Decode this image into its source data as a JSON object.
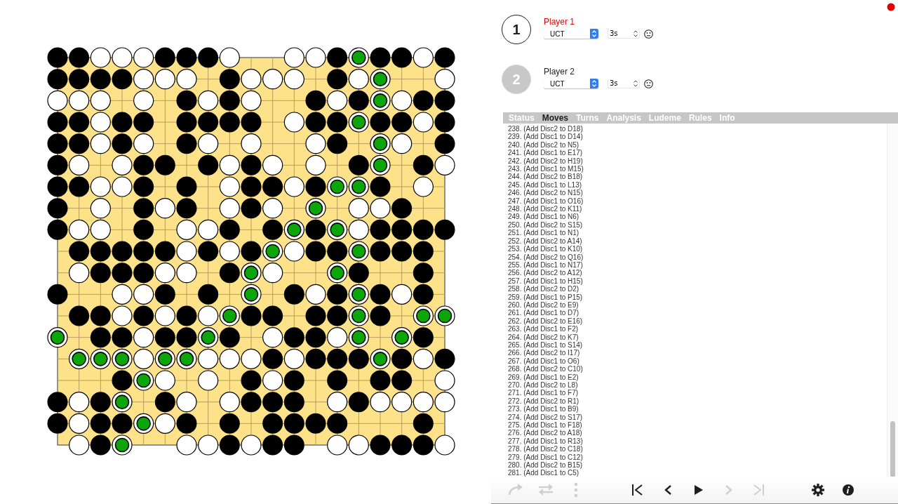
{
  "board": {
    "rows": [
      {
        "cells": [
          {
            "kind": "black"
          },
          {
            "kind": "black"
          },
          {
            "kind": "white"
          },
          {
            "kind": "white"
          },
          {
            "kind": "white"
          },
          {
            "kind": "black"
          },
          {
            "kind": "black"
          },
          {
            "kind": "black"
          },
          {
            "kind": "white"
          },
          {
            "kind": "empty"
          },
          {
            "kind": "empty"
          },
          {
            "kind": "white"
          },
          {
            "kind": "white"
          },
          {
            "kind": "black"
          },
          {
            "kind": "marked"
          },
          {
            "kind": "black"
          },
          {
            "kind": "black"
          },
          {
            "kind": "white"
          },
          {
            "kind": "black"
          }
        ]
      },
      {
        "cells": [
          {
            "kind": "black"
          },
          {
            "kind": "black"
          },
          {
            "kind": "black"
          },
          {
            "kind": "black"
          },
          {
            "kind": "white"
          },
          {
            "kind": "white"
          },
          {
            "kind": "white"
          },
          {
            "kind": "empty"
          },
          {
            "kind": "black"
          },
          {
            "kind": "white"
          },
          {
            "kind": "white"
          },
          {
            "kind": "white"
          },
          {
            "kind": "empty"
          },
          {
            "kind": "black"
          },
          {
            "kind": "white"
          },
          {
            "kind": "marked"
          },
          {
            "kind": "empty"
          },
          {
            "kind": "empty"
          },
          {
            "kind": "white"
          }
        ]
      },
      {
        "cells": [
          {
            "kind": "white"
          },
          {
            "kind": "white"
          },
          {
            "kind": "white"
          },
          {
            "kind": "empty"
          },
          {
            "kind": "white"
          },
          {
            "kind": "empty"
          },
          {
            "kind": "black"
          },
          {
            "kind": "white"
          },
          {
            "kind": "black"
          },
          {
            "kind": "white"
          },
          {
            "kind": "empty"
          },
          {
            "kind": "empty"
          },
          {
            "kind": "black"
          },
          {
            "kind": "white"
          },
          {
            "kind": "black"
          },
          {
            "kind": "marked"
          },
          {
            "kind": "white"
          },
          {
            "kind": "black"
          },
          {
            "kind": "black"
          }
        ]
      },
      {
        "cells": [
          {
            "kind": "black"
          },
          {
            "kind": "black"
          },
          {
            "kind": "white"
          },
          {
            "kind": "black"
          },
          {
            "kind": "black"
          },
          {
            "kind": "empty"
          },
          {
            "kind": "black"
          },
          {
            "kind": "black"
          },
          {
            "kind": "black"
          },
          {
            "kind": "black"
          },
          {
            "kind": "empty"
          },
          {
            "kind": "white"
          },
          {
            "kind": "black"
          },
          {
            "kind": "black"
          },
          {
            "kind": "marked"
          },
          {
            "kind": "black"
          },
          {
            "kind": "black"
          },
          {
            "kind": "white"
          },
          {
            "kind": "black"
          }
        ]
      },
      {
        "cells": [
          {
            "kind": "black"
          },
          {
            "kind": "black"
          },
          {
            "kind": "white"
          },
          {
            "kind": "black"
          },
          {
            "kind": "white"
          },
          {
            "kind": "empty"
          },
          {
            "kind": "black"
          },
          {
            "kind": "white"
          },
          {
            "kind": "empty"
          },
          {
            "kind": "white"
          },
          {
            "kind": "empty"
          },
          {
            "kind": "empty"
          },
          {
            "kind": "white"
          },
          {
            "kind": "black"
          },
          {
            "kind": "empty"
          },
          {
            "kind": "marked"
          },
          {
            "kind": "white"
          },
          {
            "kind": "empty"
          },
          {
            "kind": "black"
          }
        ]
      },
      {
        "cells": [
          {
            "kind": "black"
          },
          {
            "kind": "white"
          },
          {
            "kind": "empty"
          },
          {
            "kind": "white"
          },
          {
            "kind": "black"
          },
          {
            "kind": "black"
          },
          {
            "kind": "empty"
          },
          {
            "kind": "black"
          },
          {
            "kind": "white"
          },
          {
            "kind": "black"
          },
          {
            "kind": "white"
          },
          {
            "kind": "empty"
          },
          {
            "kind": "white"
          },
          {
            "kind": "empty"
          },
          {
            "kind": "black"
          },
          {
            "kind": "marked"
          },
          {
            "kind": "empty"
          },
          {
            "kind": "black"
          },
          {
            "kind": "white"
          }
        ]
      },
      {
        "cells": [
          {
            "kind": "black"
          },
          {
            "kind": "black"
          },
          {
            "kind": "white"
          },
          {
            "kind": "white"
          },
          {
            "kind": "black"
          },
          {
            "kind": "empty"
          },
          {
            "kind": "black"
          },
          {
            "kind": "empty"
          },
          {
            "kind": "white"
          },
          {
            "kind": "black"
          },
          {
            "kind": "black"
          },
          {
            "kind": "white"
          },
          {
            "kind": "black"
          },
          {
            "kind": "marked"
          },
          {
            "kind": "marked"
          },
          {
            "kind": "black"
          },
          {
            "kind": "empty"
          },
          {
            "kind": "white"
          },
          {
            "kind": "empty"
          }
        ]
      },
      {
        "cells": [
          {
            "kind": "black"
          },
          {
            "kind": "empty"
          },
          {
            "kind": "white"
          },
          {
            "kind": "empty"
          },
          {
            "kind": "black"
          },
          {
            "kind": "white"
          },
          {
            "kind": "black"
          },
          {
            "kind": "empty"
          },
          {
            "kind": "white"
          },
          {
            "kind": "black"
          },
          {
            "kind": "white"
          },
          {
            "kind": "empty"
          },
          {
            "kind": "marked"
          },
          {
            "kind": "empty"
          },
          {
            "kind": "white"
          },
          {
            "kind": "white"
          },
          {
            "kind": "black"
          },
          {
            "kind": "empty"
          },
          {
            "kind": "empty"
          }
        ]
      },
      {
        "cells": [
          {
            "kind": "black"
          },
          {
            "kind": "white"
          },
          {
            "kind": "white"
          },
          {
            "kind": "empty"
          },
          {
            "kind": "black"
          },
          {
            "kind": "empty"
          },
          {
            "kind": "white"
          },
          {
            "kind": "white"
          },
          {
            "kind": "black"
          },
          {
            "kind": "empty"
          },
          {
            "kind": "black"
          },
          {
            "kind": "marked"
          },
          {
            "kind": "black"
          },
          {
            "kind": "marked"
          },
          {
            "kind": "white"
          },
          {
            "kind": "black"
          },
          {
            "kind": "black"
          },
          {
            "kind": "black"
          },
          {
            "kind": "black"
          }
        ]
      },
      {
        "cells": [
          {
            "kind": "empty"
          },
          {
            "kind": "black"
          },
          {
            "kind": "black"
          },
          {
            "kind": "black"
          },
          {
            "kind": "black"
          },
          {
            "kind": "black"
          },
          {
            "kind": "white"
          },
          {
            "kind": "black"
          },
          {
            "kind": "white"
          },
          {
            "kind": "black"
          },
          {
            "kind": "marked"
          },
          {
            "kind": "white"
          },
          {
            "kind": "black"
          },
          {
            "kind": "black"
          },
          {
            "kind": "marked"
          },
          {
            "kind": "black"
          },
          {
            "kind": "black"
          },
          {
            "kind": "black"
          },
          {
            "kind": "empty"
          }
        ]
      },
      {
        "cells": [
          {
            "kind": "empty"
          },
          {
            "kind": "white"
          },
          {
            "kind": "black"
          },
          {
            "kind": "black"
          },
          {
            "kind": "black"
          },
          {
            "kind": "white"
          },
          {
            "kind": "white"
          },
          {
            "kind": "empty"
          },
          {
            "kind": "black"
          },
          {
            "kind": "marked"
          },
          {
            "kind": "white"
          },
          {
            "kind": "empty"
          },
          {
            "kind": "empty"
          },
          {
            "kind": "marked"
          },
          {
            "kind": "black"
          },
          {
            "kind": "empty"
          },
          {
            "kind": "empty"
          },
          {
            "kind": "black"
          },
          {
            "kind": "empty"
          }
        ]
      },
      {
        "cells": [
          {
            "kind": "black"
          },
          {
            "kind": "empty"
          },
          {
            "kind": "empty"
          },
          {
            "kind": "white"
          },
          {
            "kind": "white"
          },
          {
            "kind": "black"
          },
          {
            "kind": "empty"
          },
          {
            "kind": "black"
          },
          {
            "kind": "empty"
          },
          {
            "kind": "marked"
          },
          {
            "kind": "empty"
          },
          {
            "kind": "black"
          },
          {
            "kind": "white"
          },
          {
            "kind": "black"
          },
          {
            "kind": "marked"
          },
          {
            "kind": "black"
          },
          {
            "kind": "white"
          },
          {
            "kind": "black"
          },
          {
            "kind": "empty"
          }
        ]
      },
      {
        "cells": [
          {
            "kind": "empty"
          },
          {
            "kind": "black"
          },
          {
            "kind": "black"
          },
          {
            "kind": "white"
          },
          {
            "kind": "black"
          },
          {
            "kind": "white"
          },
          {
            "kind": "black"
          },
          {
            "kind": "white"
          },
          {
            "kind": "marked"
          },
          {
            "kind": "black"
          },
          {
            "kind": "black"
          },
          {
            "kind": "empty"
          },
          {
            "kind": "black"
          },
          {
            "kind": "black"
          },
          {
            "kind": "marked"
          },
          {
            "kind": "black"
          },
          {
            "kind": "empty"
          },
          {
            "kind": "marked"
          },
          {
            "kind": "marked"
          }
        ]
      },
      {
        "cells": [
          {
            "kind": "marked"
          },
          {
            "kind": "empty"
          },
          {
            "kind": "black"
          },
          {
            "kind": "black"
          },
          {
            "kind": "white"
          },
          {
            "kind": "black"
          },
          {
            "kind": "black"
          },
          {
            "kind": "marked"
          },
          {
            "kind": "black"
          },
          {
            "kind": "empty"
          },
          {
            "kind": "white"
          },
          {
            "kind": "black"
          },
          {
            "kind": "black"
          },
          {
            "kind": "white"
          },
          {
            "kind": "marked"
          },
          {
            "kind": "empty"
          },
          {
            "kind": "marked"
          },
          {
            "kind": "black"
          },
          {
            "kind": "empty"
          }
        ]
      },
      {
        "cells": [
          {
            "kind": "empty"
          },
          {
            "kind": "marked"
          },
          {
            "kind": "marked"
          },
          {
            "kind": "marked"
          },
          {
            "kind": "white"
          },
          {
            "kind": "marked"
          },
          {
            "kind": "marked"
          },
          {
            "kind": "white"
          },
          {
            "kind": "white"
          },
          {
            "kind": "white"
          },
          {
            "kind": "black"
          },
          {
            "kind": "white"
          },
          {
            "kind": "black"
          },
          {
            "kind": "black"
          },
          {
            "kind": "black"
          },
          {
            "kind": "marked"
          },
          {
            "kind": "black"
          },
          {
            "kind": "white"
          },
          {
            "kind": "black"
          }
        ]
      },
      {
        "cells": [
          {
            "kind": "empty"
          },
          {
            "kind": "empty"
          },
          {
            "kind": "empty"
          },
          {
            "kind": "black"
          },
          {
            "kind": "marked"
          },
          {
            "kind": "white"
          },
          {
            "kind": "empty"
          },
          {
            "kind": "white"
          },
          {
            "kind": "empty"
          },
          {
            "kind": "black"
          },
          {
            "kind": "white"
          },
          {
            "kind": "black"
          },
          {
            "kind": "empty"
          },
          {
            "kind": "black"
          },
          {
            "kind": "empty"
          },
          {
            "kind": "black"
          },
          {
            "kind": "black"
          },
          {
            "kind": "empty"
          },
          {
            "kind": "white"
          }
        ]
      },
      {
        "cells": [
          {
            "kind": "black"
          },
          {
            "kind": "white"
          },
          {
            "kind": "black"
          },
          {
            "kind": "marked"
          },
          {
            "kind": "empty"
          },
          {
            "kind": "black"
          },
          {
            "kind": "white"
          },
          {
            "kind": "empty"
          },
          {
            "kind": "white"
          },
          {
            "kind": "black"
          },
          {
            "kind": "black"
          },
          {
            "kind": "black"
          },
          {
            "kind": "empty"
          },
          {
            "kind": "white"
          },
          {
            "kind": "black"
          },
          {
            "kind": "white"
          },
          {
            "kind": "white"
          },
          {
            "kind": "white"
          },
          {
            "kind": "white"
          }
        ]
      },
      {
        "cells": [
          {
            "kind": "black"
          },
          {
            "kind": "white"
          },
          {
            "kind": "black"
          },
          {
            "kind": "black"
          },
          {
            "kind": "marked"
          },
          {
            "kind": "white"
          },
          {
            "kind": "black"
          },
          {
            "kind": "empty"
          },
          {
            "kind": "black"
          },
          {
            "kind": "empty"
          },
          {
            "kind": "black"
          },
          {
            "kind": "black"
          },
          {
            "kind": "black"
          },
          {
            "kind": "black"
          },
          {
            "kind": "empty"
          },
          {
            "kind": "empty"
          },
          {
            "kind": "empty"
          },
          {
            "kind": "black"
          },
          {
            "kind": "empty"
          }
        ]
      },
      {
        "cells": [
          {
            "kind": "empty"
          },
          {
            "kind": "white"
          },
          {
            "kind": "black"
          },
          {
            "kind": "marked"
          },
          {
            "kind": "empty"
          },
          {
            "kind": "empty"
          },
          {
            "kind": "white"
          },
          {
            "kind": "white"
          },
          {
            "kind": "black"
          },
          {
            "kind": "white"
          },
          {
            "kind": "black"
          },
          {
            "kind": "black"
          },
          {
            "kind": "empty"
          },
          {
            "kind": "white"
          },
          {
            "kind": "white"
          },
          {
            "kind": "black"
          },
          {
            "kind": "black"
          },
          {
            "kind": "black"
          },
          {
            "kind": "white"
          }
        ]
      }
    ]
  },
  "players": [
    {
      "number": "1",
      "name": "Player 1",
      "active": true,
      "ai": "UCT",
      "time": "3s"
    },
    {
      "number": "2",
      "name": "Player 2",
      "active": false,
      "ai": "UCT",
      "time": "3s"
    }
  ],
  "tabs": [
    {
      "label": "Status",
      "selected": false
    },
    {
      "label": "Moves",
      "selected": true
    },
    {
      "label": "Turns",
      "selected": false
    },
    {
      "label": "Analysis",
      "selected": false
    },
    {
      "label": "Ludeme",
      "selected": false
    },
    {
      "label": "Rules",
      "selected": false
    },
    {
      "label": "Info",
      "selected": false
    }
  ],
  "moves": [
    "238. (Add Disc2 to D18)",
    "239. (Add Disc1 to D14)",
    "240. (Add Disc2 to N5)",
    "241. (Add Disc1 to E17)",
    "242. (Add Disc2 to H19)",
    "243. (Add Disc1 to M15)",
    "244. (Add Disc2 to B18)",
    "245. (Add Disc1 to L13)",
    "246. (Add Disc2 to N15)",
    "247. (Add Disc1 to O16)",
    "248. (Add Disc2 to K11)",
    "249. (Add Disc1 to N6)",
    "250. (Add Disc2 to S15)",
    "251. (Add Disc1 to N1)",
    "252. (Add Disc2 to A14)",
    "253. (Add Disc1 to K10)",
    "254. (Add Disc2 to Q16)",
    "255. (Add Disc1 to N17)",
    "256. (Add Disc2 to A12)",
    "257. (Add Disc1 to H15)",
    "258. (Add Disc2 to D2)",
    "259. (Add Disc1 to P15)",
    "260. (Add Disc2 to E9)",
    "261. (Add Disc1 to D7)",
    "262. (Add Disc2 to E16)",
    "263. (Add Disc1 to F2)",
    "264. (Add Disc2 to K7)",
    "265. (Add Disc1 to S14)",
    "266. (Add Disc2 to I17)",
    "267. (Add Disc1 to O6)",
    "268. (Add Disc2 to C10)",
    "269. (Add Disc1 to E2)",
    "270. (Add Disc2 to L8)",
    "271. (Add Disc1 to F7)",
    "272. (Add Disc2 to R1)",
    "273. (Add Disc1 to B9)",
    "274. (Add Disc2 to S17)",
    "275. (Add Disc1 to F18)",
    "276. (Add Disc2 to A18)",
    "277. (Add Disc1 to R13)",
    "278. (Add Disc2 to C18)",
    "279. (Add Disc1 to C12)",
    "280. (Add Disc2 to B15)",
    "281. (Add Disc1 to C5)"
  ],
  "toolbar": [
    {
      "kind": "redo",
      "disabled": true
    },
    {
      "kind": "swap",
      "disabled": true
    },
    {
      "kind": "more",
      "disabled": true
    },
    {
      "kind": "first",
      "disabled": false
    },
    {
      "kind": "previous",
      "disabled": false
    },
    {
      "kind": "play",
      "disabled": false
    },
    {
      "kind": "next",
      "disabled": true
    },
    {
      "kind": "last",
      "disabled": true
    },
    {
      "kind": "settings",
      "disabled": false
    },
    {
      "kind": "info",
      "disabled": false
    }
  ]
}
